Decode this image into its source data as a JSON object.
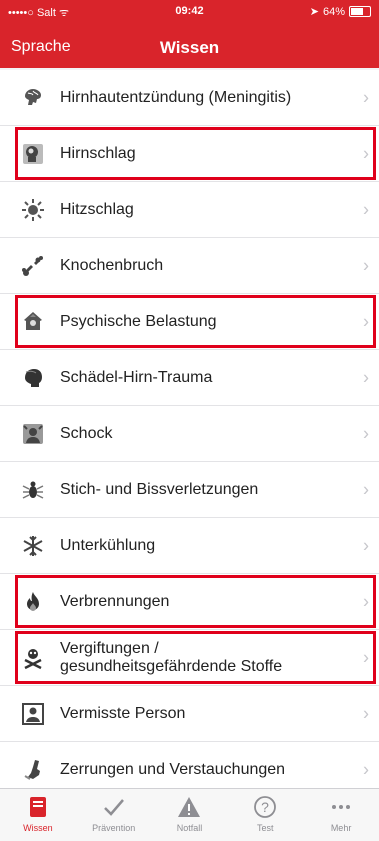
{
  "status": {
    "carrier": "•••••○ Salt ᯤ",
    "time": "09:42",
    "battery": "64%"
  },
  "nav": {
    "back": "Sprache",
    "title": "Wissen"
  },
  "items": [
    {
      "label": "Hirnhautentzündung (Meningitis)",
      "icon": "brain-icon",
      "highlighted": false
    },
    {
      "label": "Hirnschlag",
      "icon": "head-icon",
      "highlighted": true
    },
    {
      "label": "Hitzschlag",
      "icon": "sun-icon",
      "highlighted": false
    },
    {
      "label": "Knochenbruch",
      "icon": "bone-icon",
      "highlighted": false
    },
    {
      "label": "Psychische Belastung",
      "icon": "psyche-icon",
      "highlighted": true
    },
    {
      "label": "Schädel-Hirn-Trauma",
      "icon": "skull-icon",
      "highlighted": false
    },
    {
      "label": "Schock",
      "icon": "shock-icon",
      "highlighted": false
    },
    {
      "label": "Stich- und Bissverletzungen",
      "icon": "insect-icon",
      "highlighted": false
    },
    {
      "label": "Unterkühlung",
      "icon": "snowflake-icon",
      "highlighted": false
    },
    {
      "label": "Verbrennungen",
      "icon": "fire-icon",
      "highlighted": true
    },
    {
      "label": "Vergiftungen /\ngesundheitsgefährdende Stoffe",
      "icon": "poison-icon",
      "highlighted": true
    },
    {
      "label": "Vermisste Person",
      "icon": "person-icon",
      "highlighted": false
    },
    {
      "label": "Zerrungen und Verstauchungen",
      "icon": "bandage-icon",
      "highlighted": false
    }
  ],
  "tabs": [
    {
      "label": "Wissen",
      "icon": "book-icon",
      "active": true
    },
    {
      "label": "Prävention",
      "icon": "check-icon",
      "active": false
    },
    {
      "label": "Notfall",
      "icon": "warning-icon",
      "active": false
    },
    {
      "label": "Test",
      "icon": "question-icon",
      "active": false
    },
    {
      "label": "Mehr",
      "icon": "more-icon",
      "active": false
    }
  ],
  "colors": {
    "accent": "#d9242b",
    "highlight": "#e0001b"
  }
}
